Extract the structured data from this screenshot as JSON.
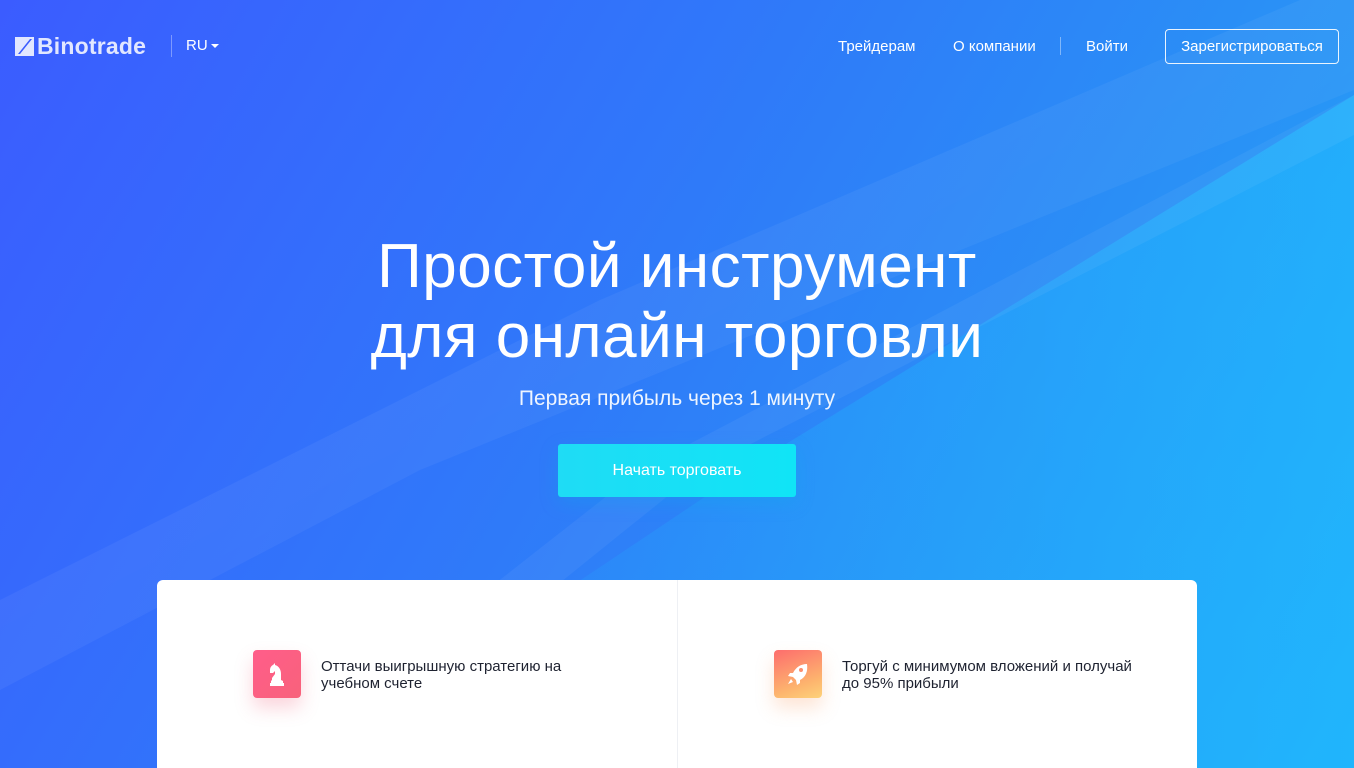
{
  "header": {
    "logo_text": "Binotrade",
    "language": "RU",
    "nav": [
      "Трейдерам",
      "О компании"
    ],
    "login_label": "Войти",
    "register_label": "Зарегистрироваться"
  },
  "hero": {
    "title_line1": "Простой инструмент",
    "title_line2": "для онлайн торговли",
    "subtitle": "Первая прибыль через 1 минуту",
    "cta_label": "Начать торговать"
  },
  "features": [
    {
      "icon": "chess-knight-icon",
      "text": "Оттачи выигрышную стратегию на учебном счете"
    },
    {
      "icon": "rocket-icon",
      "text": "Торгуй с минимумом вложений и получай до 95% прибыли"
    }
  ],
  "colors": {
    "background_start": "#3b5cff",
    "background_end": "#22a8f8",
    "cta": "#10e4f6",
    "feature_icon_pink": "#ff5d8a",
    "feature_icon_orange": "#fdb56e",
    "card_text": "#1e2230"
  }
}
